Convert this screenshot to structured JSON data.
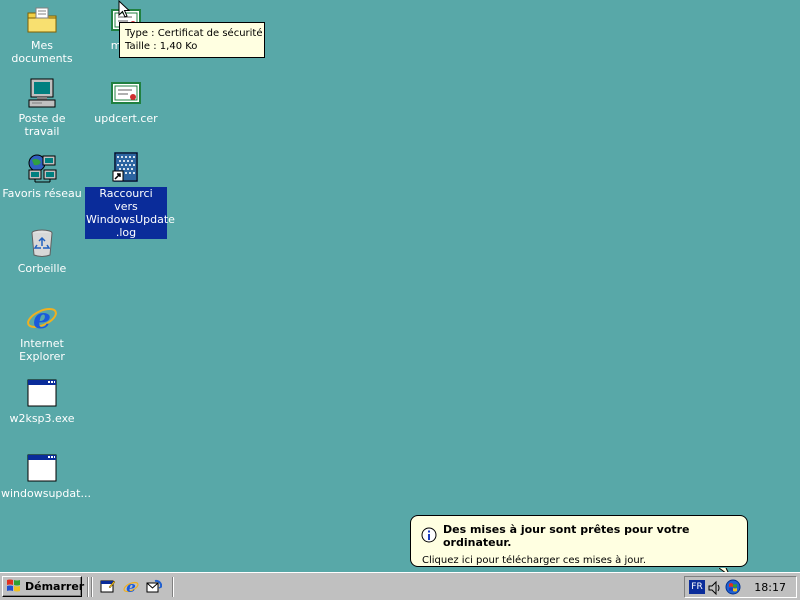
{
  "desktop": {
    "icons_left": [
      {
        "label": "Mes documents",
        "icon": "folder-documents-icon"
      },
      {
        "label": "Poste de travail",
        "icon": "computer-icon"
      },
      {
        "label": "Favoris réseau",
        "icon": "network-icon"
      },
      {
        "label": "Corbeille",
        "icon": "recycle-bin-icon"
      },
      {
        "label": "Internet Explorer",
        "icon": "internet-explorer-icon"
      },
      {
        "label": "w2ksp3.exe",
        "icon": "exe-window-icon"
      },
      {
        "label": "windowsupdat...",
        "icon": "exe-window-icon"
      }
    ],
    "icons_right": [
      {
        "label": "msr...",
        "icon": "certificate-icon"
      },
      {
        "label": "updcert.cer",
        "icon": "certificate-icon"
      },
      {
        "label_line1": "Raccourci vers",
        "label_line2": "WindowsUpdate",
        "label_line3": ".log",
        "icon": "log-shortcut-icon",
        "selected": true
      }
    ]
  },
  "tooltip": {
    "line1": "Type : Certificat de sécurité",
    "line2": "Taille  : 1,40 Ko"
  },
  "balloon": {
    "title": "Des mises à jour sont prêtes pour votre ordinateur.",
    "body": "Cliquez ici pour télécharger ces mises à jour.",
    "icon": "info-icon"
  },
  "taskbar": {
    "start_label": "Démarrer",
    "quick_launch": [
      "show-desktop-icon",
      "internet-explorer-icon",
      "outlook-express-icon"
    ],
    "tray": {
      "language": "FR",
      "icons": [
        "volume-icon",
        "windows-update-icon"
      ],
      "clock": "18:17"
    }
  },
  "colors": {
    "desktop": "#58a8a8",
    "selection": "#0a2c9a",
    "tooltip_bg": "#ffffe1",
    "taskbar": "#c0c0c0"
  }
}
